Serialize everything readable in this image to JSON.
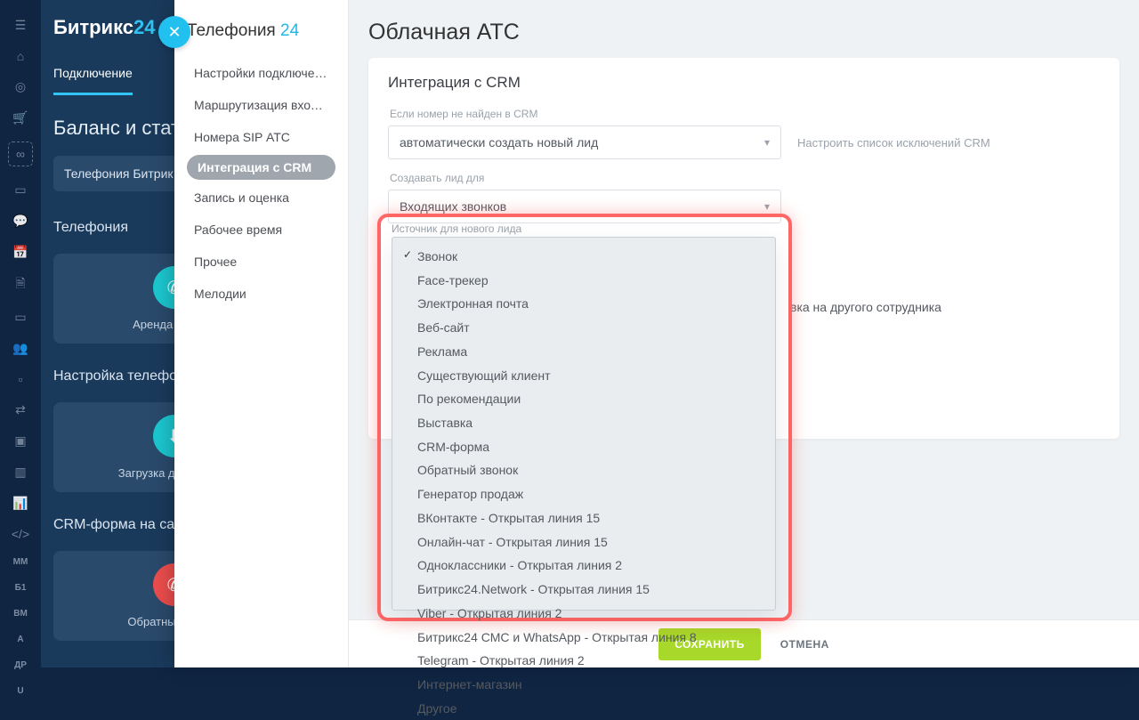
{
  "brand": {
    "name": "Битрикс",
    "suffix": "24"
  },
  "topTabs": {
    "active": "Подключение"
  },
  "balanceHeading": "Баланс и стат",
  "sideCardTitle": "Телефония Битрик",
  "sections": {
    "telephony": "Телефония",
    "settings": "Настройка телефони",
    "crmForm": "CRM-форма на сайт"
  },
  "tiles": {
    "rent": "Аренда номера",
    "upload": "Загрузка документов",
    "callback": "Обратный звонок"
  },
  "railText": {
    "mm": "MM",
    "b1": "Б1",
    "bm": "BM",
    "a": "A",
    "dr": "ДР",
    "u": "U"
  },
  "overlay": {
    "title_a": "Телефония ",
    "title_b": "24",
    "nav": [
      "Настройки подключения",
      "Маршрутизация входящ…",
      "Номера SIP АТС",
      "Интеграция с CRM",
      "Запись и оценка",
      "Рабочее время",
      "Прочее",
      "Мелодии"
    ],
    "navActiveIndex": 3
  },
  "main": {
    "pageTitle": "Облачная АТС",
    "cardTitle": "Интеграция с CRM",
    "field1_label": "Если номер не найден в CRM",
    "field1_value": "автоматически создать новый лид",
    "field1_link": "Настроить список исключений CRM",
    "field2_label": "Создавать лид для",
    "field2_value": "Входящих звонков",
    "field3_label": "Источник для нового лида",
    "truncatedRowText": "вка на другого сотрудника"
  },
  "dropdown": {
    "selectedIndex": 0,
    "options": [
      "Звонок",
      "Face-трекер",
      "Электронная почта",
      "Веб-сайт",
      "Реклама",
      "Существующий клиент",
      "По рекомендации",
      "Выставка",
      "CRM-форма",
      "Обратный звонок",
      "Генератор продаж",
      "ВКонтакте - Открытая линия 15",
      "Онлайн-чат - Открытая линия 15",
      "Одноклассники - Открытая линия 2",
      "Битрикс24.Network - Открытая линия 15",
      "Viber - Открытая линия 2",
      "Битрикс24 СМС и WhatsApp - Открытая линия 8",
      "Telegram - Открытая линия 2",
      "Интернет-магазин",
      "Другое"
    ]
  },
  "footer": {
    "save": "СОХРАНИТЬ",
    "cancel": "ОТМЕНА"
  }
}
